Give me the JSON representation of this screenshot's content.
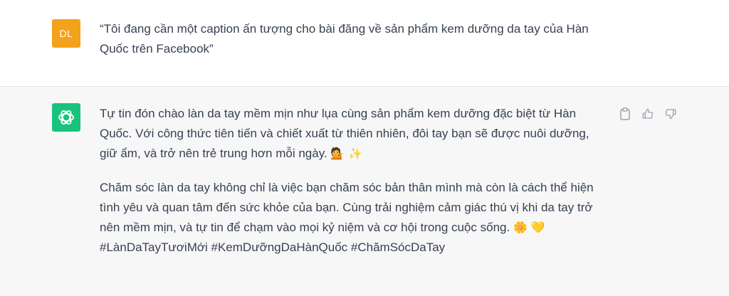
{
  "user": {
    "avatar_initials": "DL",
    "avatar_color": "#f3a21a",
    "message": "“Tôi đang cần một caption ấn tượng cho bài đăng về sản phẩm kem dưỡng da tay của Hàn Quốc trên Facebook”"
  },
  "assistant": {
    "avatar_icon": "openai-logo-icon",
    "avatar_color": "#19c37d",
    "paragraph1": {
      "text": "Tự tin đón chào làn da tay mềm mịn như lụa cùng sản phẩm kem dưỡng đặc biệt từ Hàn Quốc. Với công thức tiên tiến và chiết xuất từ thiên nhiên, đôi tay bạn sẽ được nuôi dưỡng, giữ ẩm, và trở nên trẻ trung hơn mỗi ngày.",
      "emoji1": "💁",
      "emoji2": "✨"
    },
    "paragraph2": {
      "text": "Chăm sóc làn da tay không chỉ là việc bạn chăm sóc bản thân mình mà còn là cách thể hiện tình yêu và quan tâm đến sức khỏe của bạn. Cùng trải nghiệm cảm giác thú vị khi da tay trở nên mềm mịn, và tự tin để chạm vào mọi kỷ niệm và cơ hội trong cuộc sống.",
      "emoji1": "🌼",
      "emoji2": "💛",
      "hashtags": "#LànDaTayTươiMới #KemDưỡngDaHànQuốc #ChămSócDaTay"
    }
  },
  "actions": {
    "copy_icon": "clipboard-icon",
    "like_icon": "thumbs-up-icon",
    "dislike_icon": "thumbs-down-icon"
  }
}
